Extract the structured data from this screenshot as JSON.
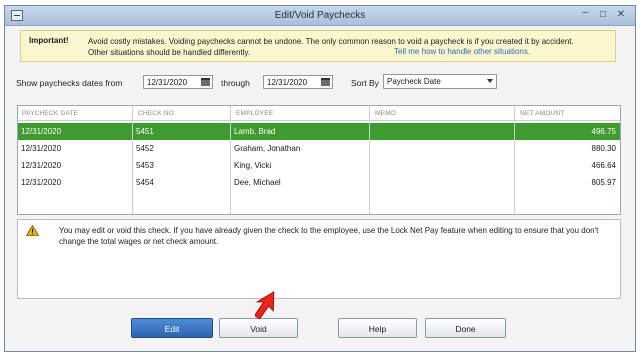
{
  "window": {
    "title": "Edit/Void Paychecks"
  },
  "notice": {
    "label": "Important!",
    "text": "Avoid costly mistakes. Voiding paychecks cannot be undone. The only common reason to void a paycheck is if you created it by accident. Other situations should be handled differently.",
    "link": "Tell me how to handle other situations."
  },
  "filter": {
    "from_label": "Show paychecks dates from",
    "from_value": "12/31/2020",
    "through_label": "through",
    "through_value": "12/31/2020",
    "sort_label": "Sort By",
    "sort_value": "Paycheck Date"
  },
  "table": {
    "headers": [
      "PAYCHECK DATE",
      "CHECK NO.",
      "EMPLOYEE",
      "MEMO",
      "NET AMOUNT"
    ],
    "rows": [
      {
        "date": "12/31/2020",
        "check": "5451",
        "employee": "Lamb, Brad",
        "memo": "",
        "amount": "496.75"
      },
      {
        "date": "12/31/2020",
        "check": "5452",
        "employee": "Graham, Jonathan",
        "memo": "",
        "amount": "880.30"
      },
      {
        "date": "12/31/2020",
        "check": "5453",
        "employee": "King, Vicki",
        "memo": "",
        "amount": "466.64"
      },
      {
        "date": "12/31/2020",
        "check": "5454",
        "employee": "Dee, Michael",
        "memo": "",
        "amount": "805.97"
      }
    ]
  },
  "message": {
    "text": "You may edit or void this check. If you have already given the check to the employee, use the Lock Net Pay feature when editing to ensure that you don't change the total wages or net check amount."
  },
  "buttons": {
    "edit": "Edit",
    "void": "Void",
    "help": "Help",
    "done": "Done"
  },
  "colors": {
    "selected_row": "#3d9c2d",
    "primary_button": "#2d64b0",
    "notice_bg": "#fbf6cd",
    "arrow": "#e8261c"
  }
}
